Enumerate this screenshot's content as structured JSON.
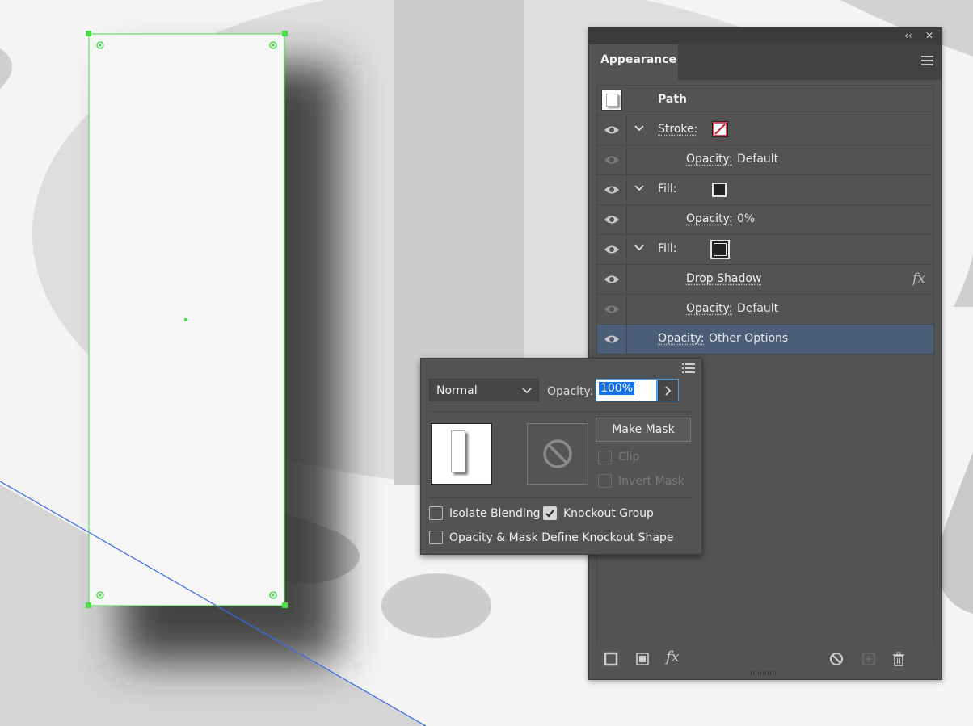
{
  "panel": {
    "title_tab": "Appearance",
    "collapse_glyph": "‹‹",
    "close_glyph": "✕"
  },
  "rows": {
    "path": "Path",
    "stroke_label": "Stroke:",
    "stroke_opacity_label": "Opacity:",
    "stroke_opacity_value": "Default",
    "fill1_label": "Fill:",
    "fill1_opacity_label": "Opacity:",
    "fill1_opacity_value": "0%",
    "fill2_label": "Fill:",
    "drop_shadow": "Drop Shadow",
    "fx_glyph": "fx",
    "fill2_opacity_label": "Opacity:",
    "fill2_opacity_value": "Default",
    "group_opacity_label": "Opacity:",
    "group_opacity_value": "Other Options"
  },
  "popup": {
    "blend_mode": "Normal",
    "opacity_label": "Opacity:",
    "opacity_value": "100%",
    "make_mask": "Make Mask",
    "clip": "Clip",
    "invert_mask": "Invert Mask",
    "isolate_blending": "Isolate Blending",
    "knockout_group": "Knockout Group",
    "opacity_mask_knockout": "Opacity & Mask Define Knockout Shape",
    "isolate_blending_checked": false,
    "knockout_group_checked": true,
    "opacity_mask_knockout_checked": false
  },
  "colors": {
    "selection_green": "#4cdb4c",
    "guide_blue": "#3a66e8",
    "panel_bg": "#535353",
    "selected_row": "#4b5e78",
    "stroke_none_red": "#d3122a"
  },
  "icons": [
    "eye-icon",
    "chevron-down-icon",
    "fx-icon",
    "panel-menu-icon",
    "new-stroke-icon",
    "new-fill-icon",
    "add-effect-icon",
    "clear-appearance-icon",
    "duplicate-item-icon",
    "delete-icon",
    "no-mask-icon",
    "options-menu-icon"
  ]
}
